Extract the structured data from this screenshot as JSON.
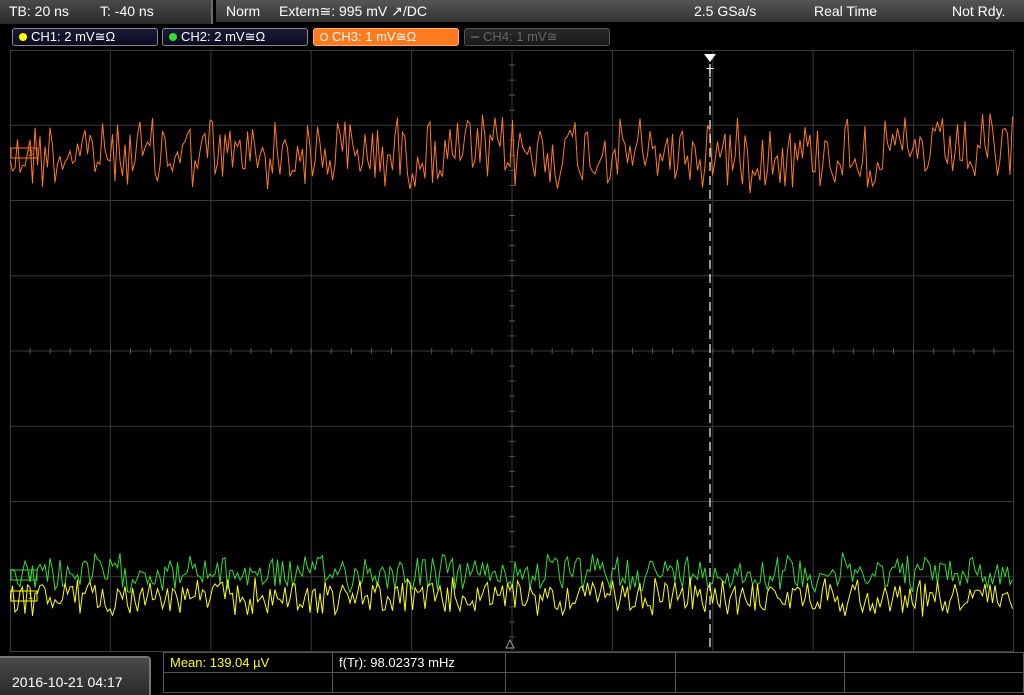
{
  "header": {
    "timebase": "TB: 20 ns",
    "trigger_time": "T: -40 ns",
    "trigger_mode": "Norm",
    "trigger_source": "Extern≅: 995 mV ↗/DC",
    "sample_rate": "2.5 GSa/s",
    "acq_mode": "Real Time",
    "status": "Not Rdy."
  },
  "channels": [
    {
      "label": "CH1: 2 mV≅Ω",
      "color": "#ffff00",
      "state": "on"
    },
    {
      "label": "CH2: 2 mV≅Ω",
      "color": "#33dd33",
      "state": "on"
    },
    {
      "label": "CH3: 1 mV≅Ω",
      "color": "#ff7a1f",
      "state": "selected"
    },
    {
      "label": "CH4: 1 mV≅",
      "color": "#666666",
      "state": "off"
    }
  ],
  "markers": {
    "trigger": "T",
    "ch3_marker": "3",
    "ch2_marker": "2",
    "ch1_marker": "1"
  },
  "footer": {
    "datetime": "2016-10-21 04:17",
    "measurement_1": "Mean: 139.04 µV",
    "measurement_2": "f(Tr): 98.02373 mHz"
  },
  "colors": {
    "ch1": "#ffff00",
    "ch2": "#33dd33",
    "ch3": "#ff7a1f",
    "grid": "#3a3a3a"
  }
}
